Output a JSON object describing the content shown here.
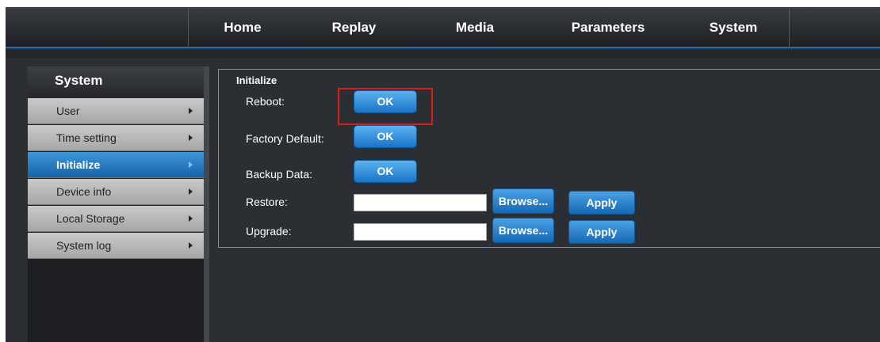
{
  "nav": {
    "items": [
      {
        "label": "Home"
      },
      {
        "label": "Replay"
      },
      {
        "label": "Media"
      },
      {
        "label": "Parameters"
      },
      {
        "label": "System"
      }
    ]
  },
  "sidebar": {
    "title": "System",
    "items": [
      {
        "label": "User",
        "active": false
      },
      {
        "label": "Time setting",
        "active": false
      },
      {
        "label": "Initialize",
        "active": true
      },
      {
        "label": "Device info",
        "active": false
      },
      {
        "label": "Local Storage",
        "active": false
      },
      {
        "label": "System log",
        "active": false
      }
    ]
  },
  "panel": {
    "title": "Initialize",
    "reboot": {
      "label": "Reboot:",
      "button": "OK"
    },
    "factory_default": {
      "label": "Factory Default:",
      "button": "OK"
    },
    "backup_data": {
      "label": "Backup Data:",
      "button": "OK"
    },
    "restore": {
      "label": "Restore:",
      "value": "",
      "browse": "Browse...",
      "apply": "Apply"
    },
    "upgrade": {
      "label": "Upgrade:",
      "value": "",
      "browse": "Browse...",
      "apply": "Apply"
    }
  },
  "colors": {
    "accent": "#1a73c6",
    "highlight": "#e0191b",
    "background": "#2b2e33"
  }
}
